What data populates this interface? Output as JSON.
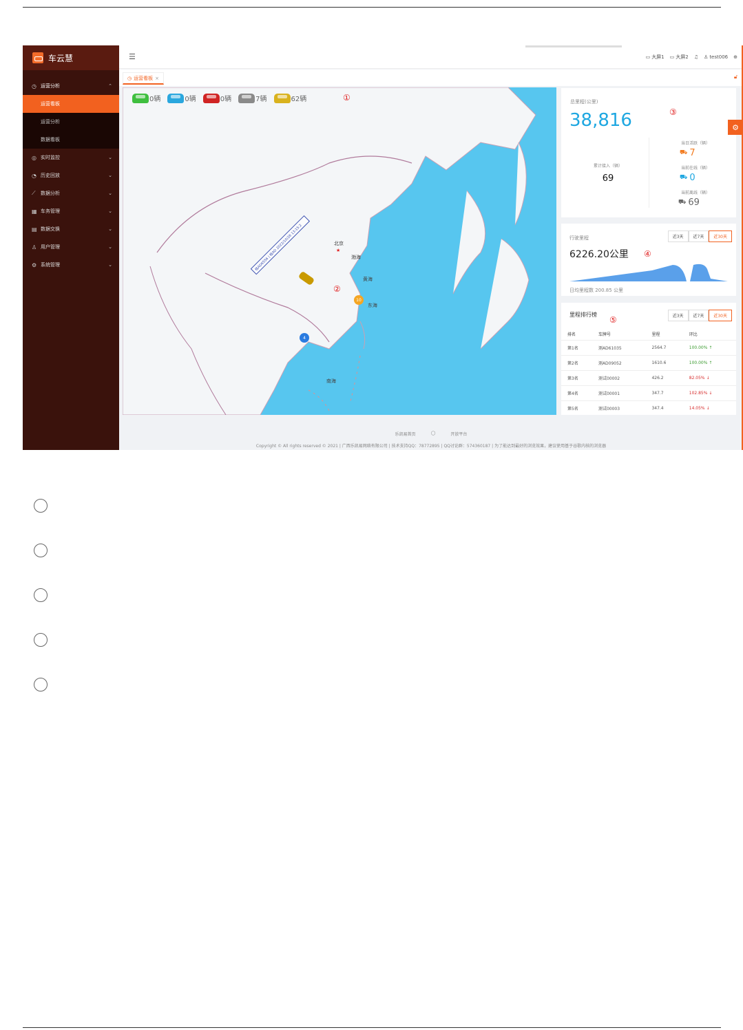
{
  "app": {
    "name": "车云慧"
  },
  "sidebar": {
    "items": [
      {
        "label": "运营分析",
        "icon": "dashboard-icon",
        "open": true,
        "children": [
          {
            "label": "运营看板",
            "active": true
          },
          {
            "label": "运营分析"
          },
          {
            "label": "数据看板"
          }
        ]
      },
      {
        "label": "实时监控",
        "icon": "eye-icon"
      },
      {
        "label": "历史回放",
        "icon": "clock-icon"
      },
      {
        "label": "数据分析",
        "icon": "chart-icon"
      },
      {
        "label": "车务管理",
        "icon": "grid-icon"
      },
      {
        "label": "数据交换",
        "icon": "exchange-icon"
      },
      {
        "label": "用户管理",
        "icon": "user-icon"
      },
      {
        "label": "系统管理",
        "icon": "gear-icon"
      }
    ]
  },
  "header": {
    "screen1": "大屏1",
    "screen2": "大屏2",
    "user": "test006"
  },
  "tabs": [
    {
      "label": "运营看板"
    }
  ],
  "map": {
    "legend": [
      {
        "count": "0辆",
        "color": "#3fbf3f"
      },
      {
        "count": "0辆",
        "color": "#2aa7de"
      },
      {
        "count": "0辆",
        "color": "#d02424"
      },
      {
        "count": "7辆",
        "color": "#8a8a8a"
      },
      {
        "count": "62辆",
        "color": "#d9b21e"
      }
    ],
    "labels": {
      "beijing": "北京",
      "bohai": "渤海",
      "huanghai": "黄海",
      "donghai": "东海",
      "nanhai": "南海"
    },
    "route_text": "桂AD6556 | 桂AD 2022/10/26 13:15:2",
    "cluster_orange": "10",
    "cluster_blue": "4",
    "marks": {
      "m1": "①",
      "m2": "②",
      "m3": "③",
      "m4": "④",
      "m5": "⑤"
    }
  },
  "stats": {
    "total_mileage_label": "总里程(公里)",
    "total_mileage": "38,816",
    "cumulative_label": "累计接入（辆）",
    "cumulative": "69",
    "today_active_label": "当日活跃（辆）",
    "today_active": "7",
    "online_label": "当前在线（辆）",
    "online": "0",
    "offline_label": "当前离线（辆）",
    "offline": "69"
  },
  "mileage": {
    "label": "行驶里程",
    "value": "6226.20公里",
    "daily_avg": "日均里程数 200.85 公里",
    "ranges": [
      "近3天",
      "近7天",
      "近30天"
    ]
  },
  "ranking": {
    "title": "里程排行榜",
    "ranges": [
      "近3天",
      "近7天",
      "近30天"
    ],
    "columns": [
      "排名",
      "车牌号",
      "里程",
      "环比"
    ],
    "rows": [
      {
        "rank": "第1名",
        "plate": "测AD61035",
        "km": "2564.7",
        "ratio": "100.00%",
        "dir": "up"
      },
      {
        "rank": "第2名",
        "plate": "测AD09052",
        "km": "1610.6",
        "ratio": "100.00%",
        "dir": "up"
      },
      {
        "rank": "第3名",
        "plate": "测试00002",
        "km": "426.2",
        "ratio": "82.05%",
        "dir": "down"
      },
      {
        "rank": "第4名",
        "plate": "测试00001",
        "km": "347.7",
        "ratio": "102.85%",
        "dir": "down"
      },
      {
        "rank": "第5名",
        "plate": "测试00003",
        "km": "347.4",
        "ratio": "14.05%",
        "dir": "down"
      }
    ]
  },
  "footer": {
    "home": "乐凯易首页",
    "open": "开放平台",
    "copyright": "Copyright © All rights reserved © 2021 | 广西乐凯易网络有限公司 | 技术支持QQ：78772895 | QQ讨论群：574360187 | 为了能达到最好的浏览效果，建议使用基于谷歌内核的浏览器"
  },
  "colors": {
    "accent": "#f2611f",
    "sidebar": "#3a120c",
    "map_sea": "#57c6ef",
    "blue_value": "#1ea7e1"
  }
}
